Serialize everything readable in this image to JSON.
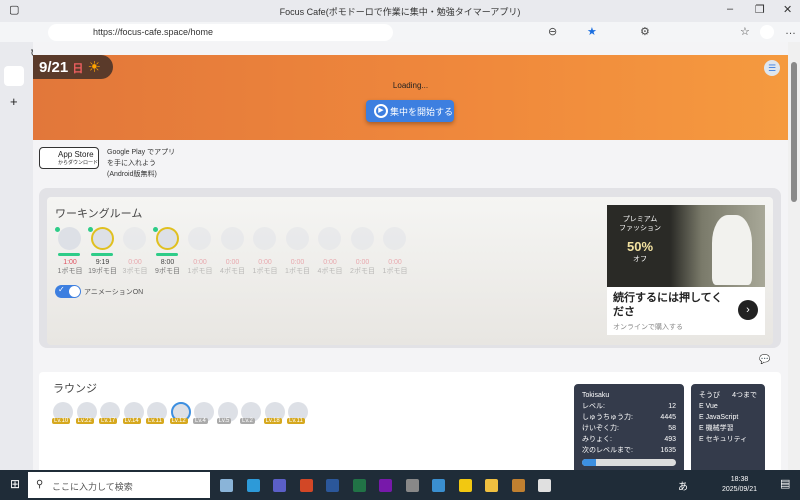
{
  "browser": {
    "title": "Focus Cafe(ポモドーロで作業に集中・勉強タイマーアプリ)",
    "url": "https://focus-cafe.space/home"
  },
  "hero": {
    "date": "9/21",
    "weekday": "日",
    "loading": "Loading...",
    "start_button": "集中を開始する"
  },
  "downloads": {
    "app_store_top": "App Store",
    "app_store_sub": "からダウンロード",
    "google_play_alt": "Google Play でアプリを手に入れよう(Android版無料)"
  },
  "working_room": {
    "title": "ワーキングルーム",
    "animation_label": "アニメーションON",
    "animation_on": true,
    "members": [
      {
        "time": "1:00",
        "pomo": "1ポモ目",
        "active": true,
        "online": true
      },
      {
        "time": "9:19",
        "pomo": "19ポモ目",
        "active": true,
        "online": true
      },
      {
        "time": "0:00",
        "pomo": "3ポモ目",
        "active": false,
        "online": false
      },
      {
        "time": "8:00",
        "pomo": "9ポモ目",
        "active": true,
        "online": true
      },
      {
        "time": "0:00",
        "pomo": "1ポモ目",
        "active": false,
        "online": false
      },
      {
        "time": "0:00",
        "pomo": "4ポモ目",
        "active": false,
        "online": false
      },
      {
        "time": "0:00",
        "pomo": "1ポモ目",
        "active": false,
        "online": false
      },
      {
        "time": "0:00",
        "pomo": "1ポモ目",
        "active": false,
        "online": false
      },
      {
        "time": "0:00",
        "pomo": "4ポモ目",
        "active": false,
        "online": false
      },
      {
        "time": "0:00",
        "pomo": "2ポモ目",
        "active": false,
        "online": false
      },
      {
        "time": "0:00",
        "pomo": "1ポモ目",
        "active": false,
        "online": false
      }
    ]
  },
  "ad": {
    "badge1": "プレミアム",
    "badge2": "ファッション",
    "discount": "50%",
    "off": "オフ",
    "headline": "続行するには押してくださ",
    "sub": "オンラインで購入する"
  },
  "lounge": {
    "title": "ラウンジ",
    "levels": [
      "Lv.10",
      "Lv.22",
      "Lv.17",
      "Lv.14",
      "Lv.11",
      "Lv.12",
      "Lv.4",
      "Lv.5",
      "Lv.2",
      "Lv.18",
      "Lv.11"
    ]
  },
  "status": {
    "name": "Tokisaku",
    "rows": [
      {
        "k": "レベル:",
        "v": "12"
      },
      {
        "k": "しゅうちゅう力:",
        "v": "4445"
      },
      {
        "k": "けいぞく力:",
        "v": "58"
      },
      {
        "k": "みりょく:",
        "v": "493"
      },
      {
        "k": "次のレベルまで:",
        "v": "1635"
      }
    ],
    "progress": 0.15
  },
  "equip": {
    "title": "そうび",
    "limit": "4つまで",
    "items": [
      "E Vue",
      "E JavaScript",
      "E 機械学習",
      "E セキュリティ"
    ]
  },
  "taskbar": {
    "search": "ここに入力して検索",
    "time": "18:38",
    "date": "2025/09/21",
    "ime": "あ"
  }
}
